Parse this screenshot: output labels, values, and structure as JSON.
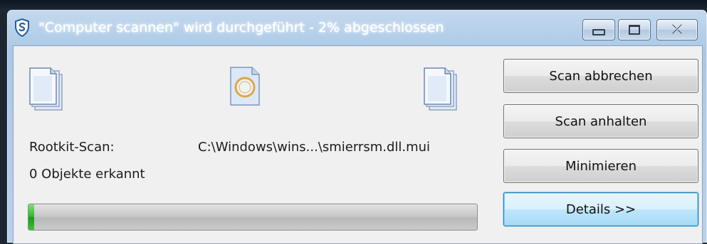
{
  "window": {
    "title": "\"Computer scannen\" wird durchgeführt - 2% abgeschlossen",
    "app_icon": "shield-s-icon",
    "controls": {
      "minimize_icon": "minimize-icon",
      "maximize_icon": "maximize-icon",
      "close_icon": "close-icon",
      "close_glyph": "⤫"
    }
  },
  "scan": {
    "left_icon": "documents-icon",
    "center_icon": "file-scanning-icon",
    "right_icon": "documents-icon",
    "type_label": "Rootkit-Scan:",
    "current_file": "C:\\Windows\\wins...\\smierrsm.dll.mui",
    "detected_label": "0 Objekte erkannt",
    "progress_fraction": 0.02
  },
  "buttons": {
    "cancel": "Scan abbrechen",
    "pause": "Scan anhalten",
    "minimize": "Minimieren",
    "details": "Details >>"
  },
  "colors": {
    "accent": "#3c7fb1",
    "progress": "#2fb52b"
  }
}
